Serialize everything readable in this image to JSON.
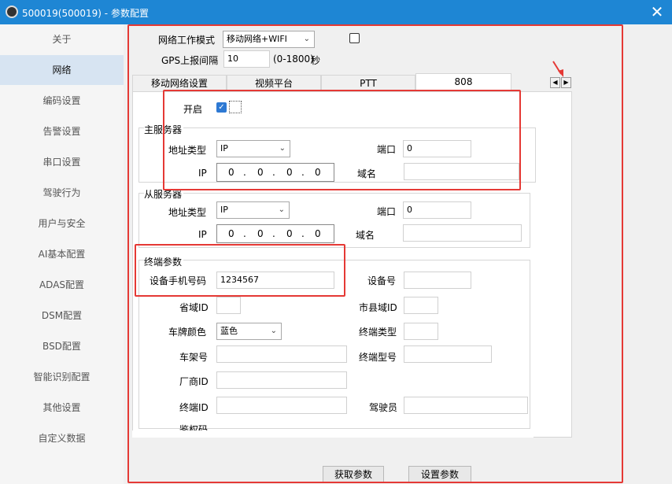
{
  "window": {
    "title": "500019(500019) - 参数配置",
    "close_icon": "close-icon",
    "app_icon": "app-icon"
  },
  "sidebar": {
    "items": [
      {
        "label": "关于"
      },
      {
        "label": "网络",
        "active": true
      },
      {
        "label": "编码设置"
      },
      {
        "label": "告警设置"
      },
      {
        "label": "串口设置"
      },
      {
        "label": "驾驶行为"
      },
      {
        "label": "用户与安全"
      },
      {
        "label": "AI基本配置"
      },
      {
        "label": "ADAS配置"
      },
      {
        "label": "DSM配置"
      },
      {
        "label": "BSD配置"
      },
      {
        "label": "智能识别配置"
      },
      {
        "label": "其他设置"
      },
      {
        "label": "自定义数据"
      }
    ]
  },
  "top": {
    "network_mode_label": "网络工作模式",
    "network_mode_value": "移动网络+WIFI",
    "gps_label": "GPS上报间隔",
    "gps_value": "10",
    "gps_range": "(0-1800)",
    "gps_unit": "秒"
  },
  "tabs": [
    {
      "label": "移动网络设置"
    },
    {
      "label": "视频平台"
    },
    {
      "label": "PTT"
    },
    {
      "label": "808",
      "active": true
    }
  ],
  "form": {
    "enable_label": "开启",
    "enable_checked": true,
    "main_server": {
      "title": "主服务器",
      "addr_type_label": "地址类型",
      "addr_type_value": "IP",
      "port_label": "端口",
      "port_value": "0",
      "ip_label": "IP",
      "ip_octets": [
        "0",
        "0",
        "0",
        "0"
      ],
      "domain_label": "域名",
      "domain_value": ""
    },
    "backup_server": {
      "title": "从服务器",
      "addr_type_label": "地址类型",
      "addr_type_value": "IP",
      "port_label": "端口",
      "port_value": "0",
      "ip_label": "IP",
      "ip_octets": [
        "0",
        "0",
        "0",
        "0"
      ],
      "domain_label": "域名",
      "domain_value": ""
    },
    "terminal": {
      "title": "终端参数",
      "phone_label": "设备手机号码",
      "phone_value": "1234567",
      "device_no_label": "设备号",
      "province_label": "省域ID",
      "city_label": "市县域ID",
      "plate_color_label": "车牌颜色",
      "plate_color_value": "蓝色",
      "terminal_type_label": "终端类型",
      "vin_label": "车架号",
      "terminal_model_label": "终端型号",
      "vendor_label": "厂商ID",
      "terminal_id_label": "终端ID",
      "driver_label": "驾驶员",
      "auth_label": "鉴权码"
    }
  },
  "buttons": {
    "get_params": "获取参数",
    "set_params": "设置参数"
  },
  "colors": {
    "titlebar": "#1e86d4",
    "highlight": "#e53935",
    "active_sidebar": "#d7e4f2",
    "checkbox": "#2e79d3"
  }
}
